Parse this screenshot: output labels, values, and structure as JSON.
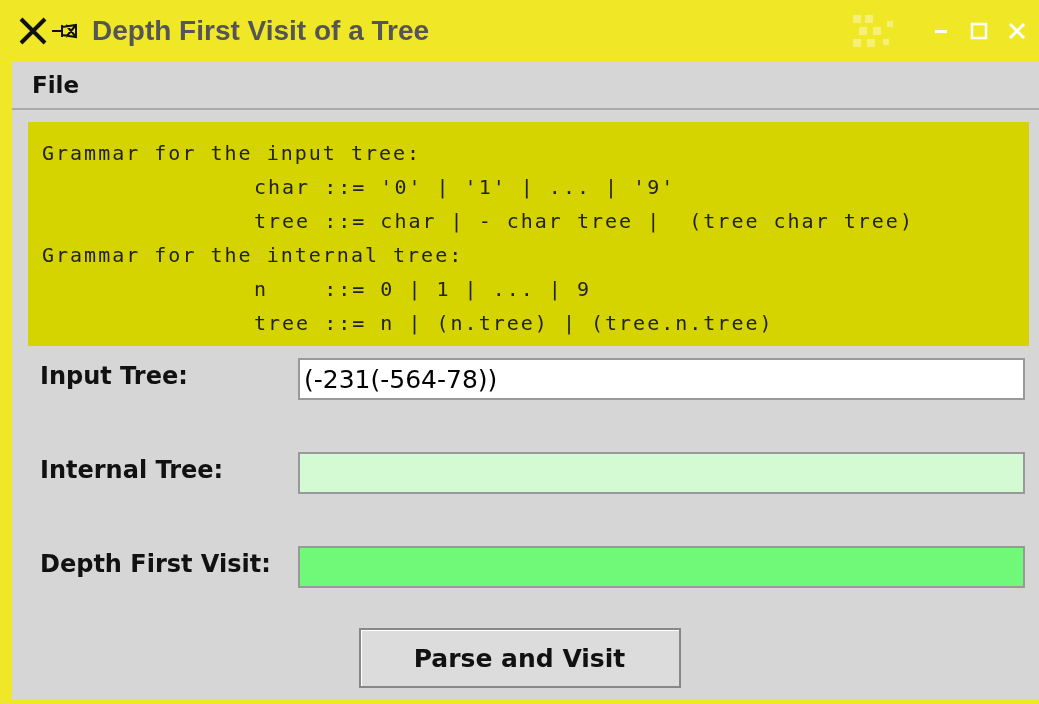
{
  "window": {
    "title": "Depth First Visit of a Tree"
  },
  "menu": [
    "File"
  ],
  "grammar": [
    {
      "indent": false,
      "text": "Grammar for the input tree:"
    },
    {
      "indent": true,
      "text": "char ::= '0' | '1' | ... | '9'"
    },
    {
      "indent": true,
      "text": "tree ::= char | - char tree |  (tree char tree)"
    },
    {
      "indent": false,
      "text": "Grammar for the internal tree:"
    },
    {
      "indent": true,
      "text": "n    ::= 0 | 1 | ... | 9"
    },
    {
      "indent": true,
      "text": "tree ::= n | (n.tree) | (tree.n.tree)"
    }
  ],
  "fields": [
    {
      "label": "Input Tree:",
      "value": "(-231(-564-78))",
      "color": "#ffffff"
    },
    {
      "label": "Internal Tree:",
      "color": "#d4fad4"
    },
    {
      "label": "Depth First Visit:",
      "color": "#70f878"
    }
  ],
  "button": "Parse and Visit"
}
